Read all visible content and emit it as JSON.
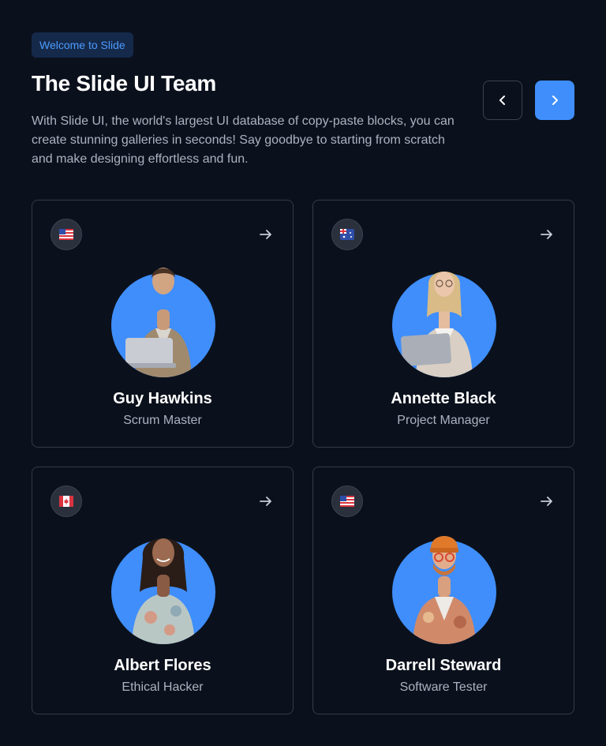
{
  "header": {
    "badge": "Welcome to Slide",
    "title": "The Slide UI Team",
    "description": "With Slide UI, the world's largest UI database of copy-paste blocks, you can create stunning galleries in seconds! Say goodbye to starting from scratch and make designing effortless and fun."
  },
  "nav": {
    "prev_icon": "chevron-left-icon",
    "next_icon": "chevron-right-icon"
  },
  "colors": {
    "background": "#0b111c",
    "accent": "#3f8efc",
    "badge_bg": "#15294a",
    "badge_text": "#4c9cff"
  },
  "team": [
    {
      "name": "Guy Hawkins",
      "role": "Scrum Master",
      "flag": "us-flag-icon"
    },
    {
      "name": "Annette Black",
      "role": "Project Manager",
      "flag": "au-flag-icon"
    },
    {
      "name": "Albert Flores",
      "role": "Ethical Hacker",
      "flag": "ca-flag-icon"
    },
    {
      "name": "Darrell Steward",
      "role": "Software Tester",
      "flag": "us-flag-icon"
    }
  ]
}
